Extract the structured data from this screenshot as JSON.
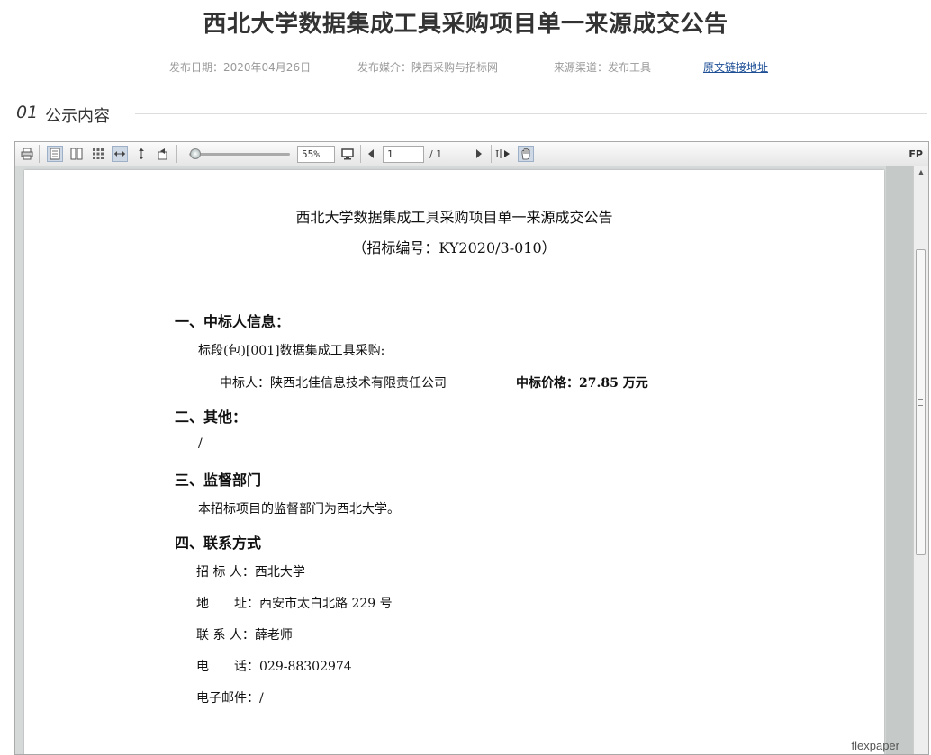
{
  "header": {
    "title": "西北大学数据集成工具采购项目单一来源成交公告",
    "publish_date": "发布日期：2020年04月26日",
    "publish_media": "发布媒介：陕西采购与招标网",
    "source_channel": "来源渠道：发布工具",
    "original_link": "原文链接地址"
  },
  "section": {
    "number": "01",
    "label": "公示内容"
  },
  "viewer": {
    "zoom": "55%",
    "page_current": "1",
    "page_total": "/ 1",
    "brand_short": "FP",
    "brand": "flexpaper"
  },
  "document": {
    "title": "西北大学数据集成工具采购项目单一来源成交公告",
    "code": "（招标编号：KY2020/3-010）",
    "s1_heading": "一、中标人信息：",
    "s1_lot": "标段(包)[001]数据集成工具采购:",
    "s1_winner": "中标人：陕西北佳信息技术有限责任公司",
    "s1_price": "中标价格：27.85 万元",
    "s2_heading": "二、其他：",
    "s2_text": "/",
    "s3_heading": "三、监督部门",
    "s3_text": "本招标项目的监督部门为西北大学。",
    "s4_heading": "四、联系方式",
    "s4_bidder": "招 标 人：西北大学",
    "s4_address": "地　　址：西安市太白北路 229 号",
    "s4_contact": "联 系 人：薛老师",
    "s4_phone": "电　　话：029-88302974",
    "s4_email": "电子邮件：/"
  }
}
